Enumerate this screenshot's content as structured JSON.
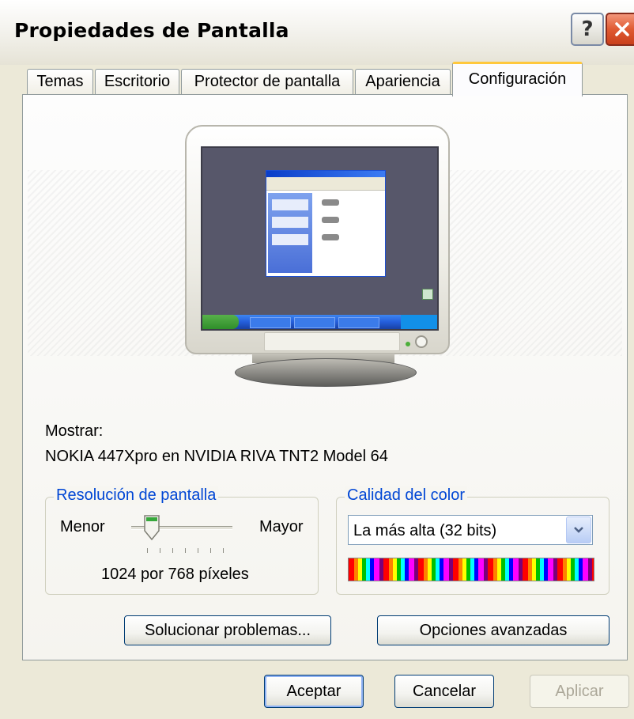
{
  "window": {
    "title": "Propiedades de Pantalla",
    "help_glyph": "?",
    "close_glyph": "✕"
  },
  "tabs": [
    {
      "label": "Temas",
      "active": false
    },
    {
      "label": "Escritorio",
      "active": false
    },
    {
      "label": "Protector de pantalla",
      "active": false
    },
    {
      "label": "Apariencia",
      "active": false
    },
    {
      "label": "Configuración",
      "active": true
    }
  ],
  "display": {
    "label": "Mostrar:",
    "device": "NOKIA 447Xpro en NVIDIA RIVA TNT2 Model 64"
  },
  "resolution": {
    "legend": "Resolución de pantalla",
    "min_label": "Menor",
    "max_label": "Mayor",
    "value_text": "1024 por 768 píxeles",
    "slider_position": 0.2
  },
  "color_quality": {
    "legend": "Calidad del color",
    "selected": "La más alta (32 bits)"
  },
  "actions": {
    "troubleshoot": "Solucionar problemas...",
    "advanced": "Opciones avanzadas"
  },
  "footer": {
    "ok": "Aceptar",
    "cancel": "Cancelar",
    "apply": "Aplicar"
  },
  "colors": {
    "legend_blue": "#0046D5",
    "close_red": "#E05A32",
    "active_tab_accent": "#FFC83C",
    "dialog_bg": "#ECE9D8"
  }
}
